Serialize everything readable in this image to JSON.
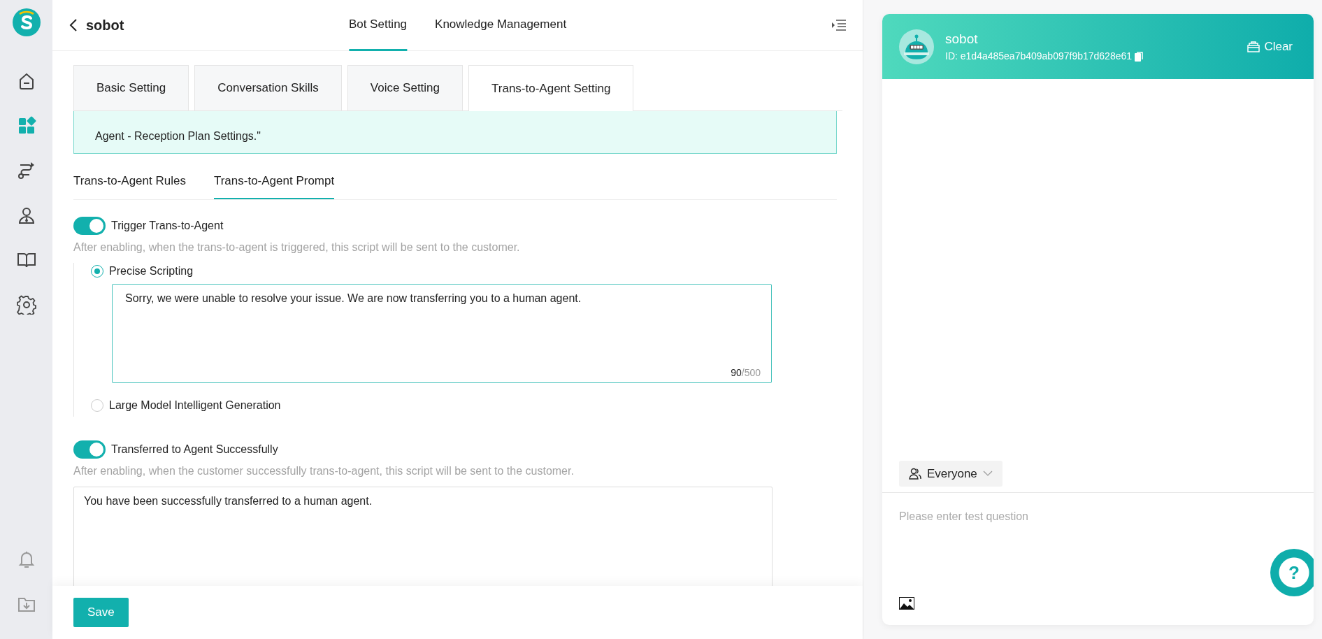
{
  "sidebar": {
    "items": [
      {
        "kind": "home",
        "selected": false
      },
      {
        "kind": "apps",
        "selected": true
      },
      {
        "kind": "flow",
        "selected": false
      },
      {
        "kind": "agent",
        "selected": false
      },
      {
        "kind": "book",
        "selected": false
      },
      {
        "kind": "gear",
        "selected": false
      }
    ],
    "bottom_items": [
      {
        "kind": "bell"
      },
      {
        "kind": "download"
      }
    ]
  },
  "header": {
    "title": "sobot",
    "tabs": [
      {
        "label": "Bot Setting",
        "selected": true
      },
      {
        "label": "Knowledge Management",
        "selected": false
      }
    ]
  },
  "setting_tabs": [
    {
      "label": "Basic Setting",
      "selected": false
    },
    {
      "label": "Conversation Skills",
      "selected": false
    },
    {
      "label": "Voice Setting",
      "selected": false
    },
    {
      "label": "Trans-to-Agent Setting",
      "selected": true
    }
  ],
  "notice": {
    "text": "Agent - Reception Plan Settings.\""
  },
  "prompt_tabs": [
    {
      "label": "Trans-to-Agent Rules",
      "selected": false
    },
    {
      "label": "Trans-to-Agent Prompt",
      "selected": true
    }
  ],
  "sections": [
    {
      "title": "Trigger Trans-to-Agent",
      "on": true,
      "hint": "After enabling, when the trans-to-agent is triggered, this script will be sent to the customer.",
      "options": [
        {
          "label": "Precise Scripting",
          "selected": true,
          "value": "Sorry, we were unable to resolve your issue. We are now transferring you to a human agent.",
          "count": "90",
          "limit": "/500"
        },
        {
          "label": "Large Model Intelligent Generation",
          "selected": false
        }
      ]
    },
    {
      "title": "Transferred to Agent Successfully",
      "on": true,
      "hint": "After enabling, when the customer successfully trans-to-agent, this script will be sent to the customer.",
      "value": "You have been successfully transferred to a human agent."
    }
  ],
  "save_button": "Save",
  "chat": {
    "name": "sobot",
    "id": "ID: e1d4a485ea7b409ab097f9b17d628e61",
    "clear": "Clear",
    "audience": "Everyone",
    "placeholder": "Please enter test question",
    "help": "?"
  }
}
